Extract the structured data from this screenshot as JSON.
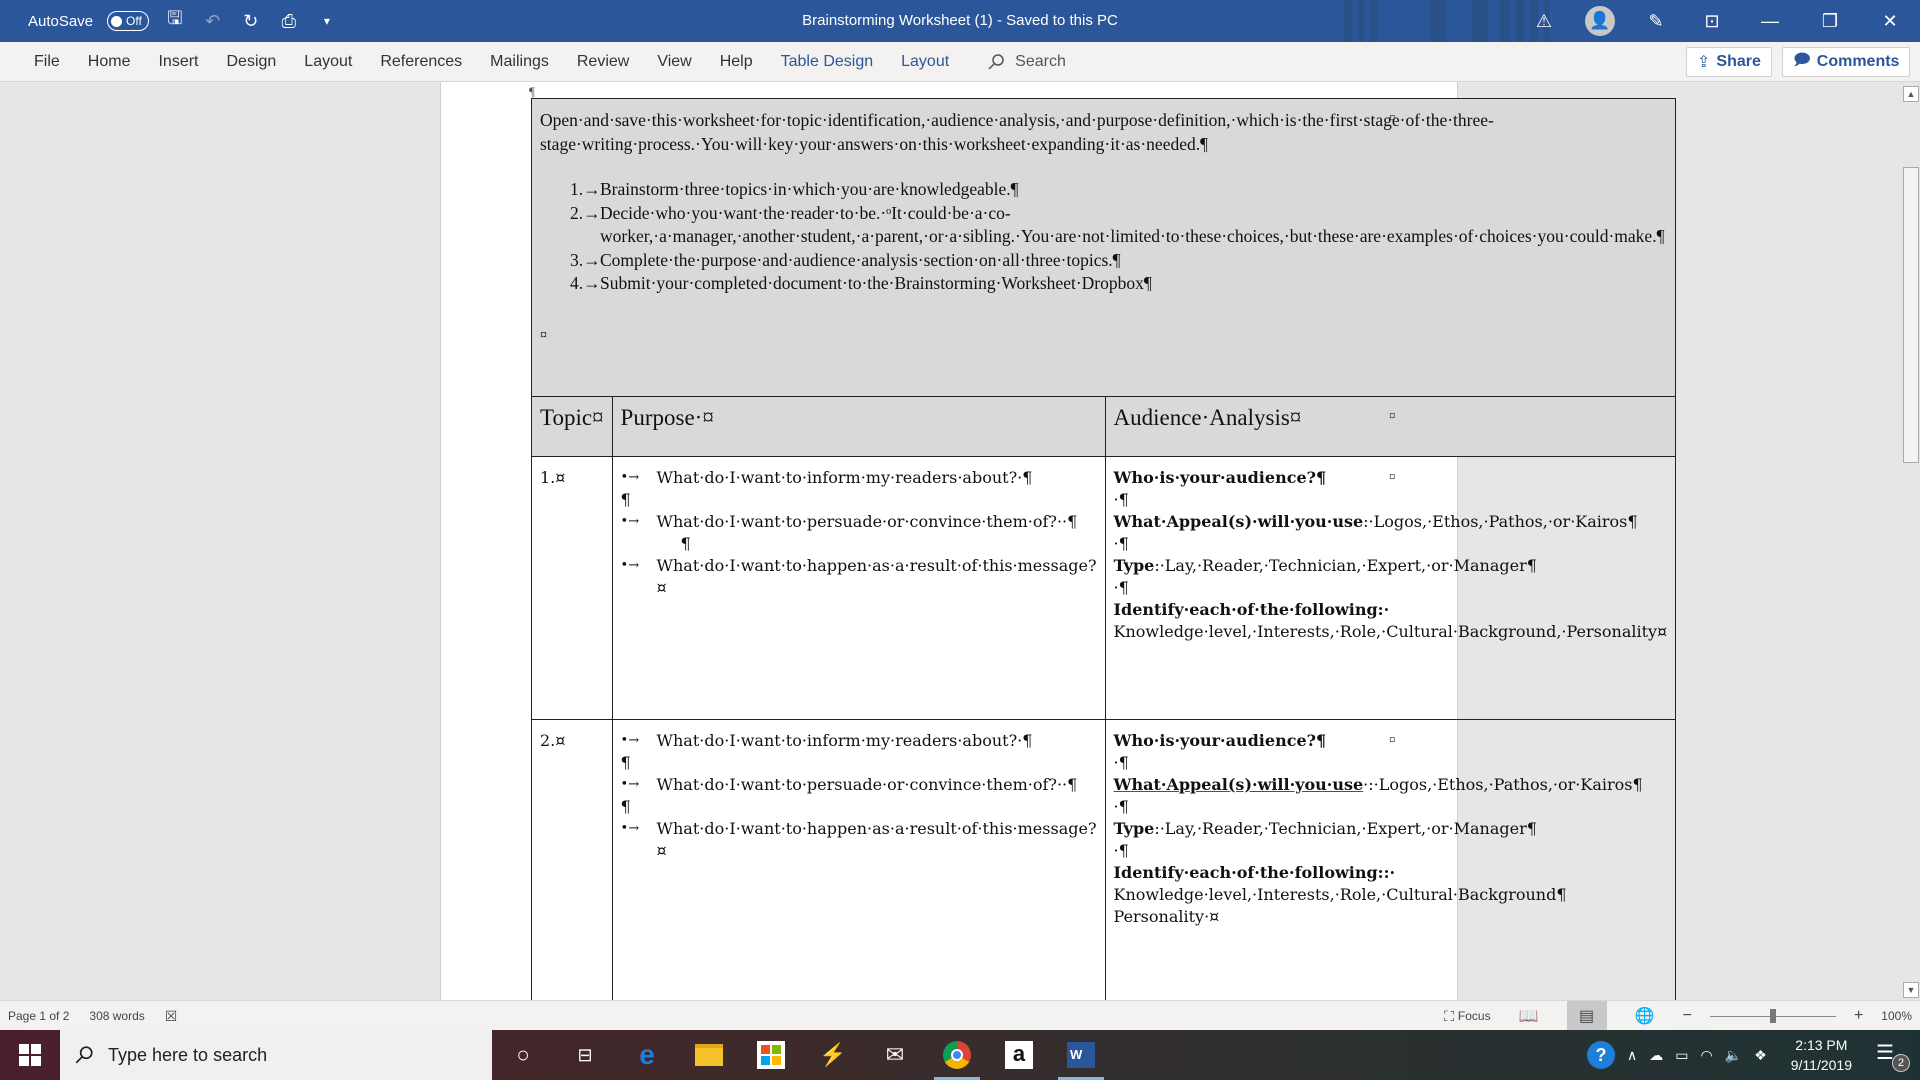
{
  "titlebar": {
    "autosave_label": "AutoSave",
    "autosave_state": "Off",
    "title": "Brainstorming Worksheet (1)  -  Saved to this PC",
    "accent": "#2b579a",
    "icons": [
      "save-icon",
      "undo-icon",
      "redo-icon",
      "print-preview-icon",
      "customize-qat-icon"
    ],
    "window_icons": [
      "warning-icon",
      "account-icon",
      "pen-icon",
      "ribbon-display-icon",
      "minimize-icon",
      "restore-icon",
      "close-icon"
    ],
    "glyphs": {
      "save": "🖫",
      "undo": "↶",
      "redo": "↻",
      "print": "⎙",
      "customize": "▾",
      "warning": "⚠",
      "account": "👤",
      "pen": "✎",
      "ribbon": "⊡",
      "minimize": "—",
      "restore": "❐",
      "close": "✕"
    }
  },
  "ribbon": {
    "tabs": [
      "File",
      "Home",
      "Insert",
      "Design",
      "Layout",
      "References",
      "Mailings",
      "Review",
      "View",
      "Help"
    ],
    "context_tabs": [
      "Table Design",
      "Layout"
    ],
    "search_label": "Search",
    "share_label": "Share",
    "comments_label": "Comments"
  },
  "document": {
    "top_pilcrow": "¶",
    "intro": {
      "paragraph": "Open·and·save·this·worksheet·for·topic·identification,·audience·analysis,·and·purpose·definition,·which·is·the·first·stage·of·the·three-stage·writing·process.·You·will·key·your·answers·on·this·worksheet·expanding·it·as·needed.¶",
      "steps": [
        {
          "num": "1.→",
          "text": "Brainstorm·three·topics·in·which·you·are·knowledgeable.¶"
        },
        {
          "num": "2.→",
          "text": "Decide·who·you·want·the·reader·to·be.·ᵒIt·could·be·a·co-worker,·a·manager,·another·student,·a·parent,·or·a·sibling.·You·are·not·limited·to·these·choices,·but·these·are·examples·of·choices·you·could·make.¶"
        },
        {
          "num": "3.→",
          "text": "Complete·the·purpose·and·audience·analysis·section·on·all·three·topics.¶"
        },
        {
          "num": "4.→",
          "text": "Submit·your·completed·document·to·the·Brainstorming·Worksheet·Dropbox¶"
        }
      ],
      "end_mark": "¤"
    },
    "headers": {
      "topic": "Topic¤",
      "purpose": "Purpose·¤",
      "audience": "Audience·Analysis¤"
    },
    "cell_mark": "¤",
    "rows": [
      {
        "topic": "1.¤",
        "purpose": [
          {
            "bullet": "•→",
            "text": "What·do·I·want·to·inform·my·readers·about?·¶"
          },
          {
            "gap": "¶"
          },
          {
            "bullet": "•→",
            "text": "What·do·I·want·to·persuade·or·convince·them·of?··¶"
          },
          {
            "gap": "¶"
          },
          {
            "bullet": "•→",
            "text": "What·do·I·want·to·happen·as·a·result·of·this·message?¤"
          }
        ],
        "audience": {
          "who": "Who·is·your·audience?¶",
          "blank": "·¶",
          "appeal_label": "What·Appeal(s)·will·you·use",
          "appeal_text": ":·Logos,·Ethos,·Pathos,·or·Kairos¶",
          "type_label": "Type",
          "type_text": ":·Lay,·Reader,·Technician,·Expert,·or·Manager¶",
          "identify_label": "Identify·each·of·the·following:·",
          "identify_text": "Knowledge·level,·Interests,·Role,·Cultural·Background,·Personality¤"
        }
      },
      {
        "topic": "2.¤",
        "purpose": [
          {
            "bullet": "•→",
            "text": "What·do·I·want·to·inform·my·readers·about?·¶"
          },
          {
            "gap": "¶"
          },
          {
            "bullet": "•→",
            "text": "What·do·I·want·to·persuade·or·convince·them·of?··¶"
          },
          {
            "gap": "¶"
          },
          {
            "bullet": "•→",
            "text": "What·do·I·want·to·happen·as·a·result·of·this·message?¤"
          }
        ],
        "audience": {
          "who": "Who·is·your·audience?¶",
          "blank": "·¶",
          "appeal_label": "What·Appeal(s)·will·you·use",
          "appeal_text": "·:·Logos,·Ethos,·Pathos,·or·Kairos¶",
          "type_label": "Type",
          "type_text": ":·Lay,·Reader,·Technician,·Expert,·or·Manager¶",
          "identify_label": "Identify·each·of·the·following::·",
          "identify_text": "Knowledge·level,·Interests,·Role,·Cultural·Background¶",
          "identify_text2": "Personality·¤"
        }
      }
    ]
  },
  "statusbar": {
    "page": "Page 1 of 2",
    "words": "308 words",
    "focus_label": "Focus",
    "zoom_minus": "−",
    "zoom_plus": "+",
    "zoom_level": "100%",
    "zoom_fraction": 0.5
  },
  "taskbar": {
    "search_placeholder": "Type here to search",
    "apps": [
      "cortana",
      "task-view",
      "edge",
      "file-explorer",
      "store",
      "app-blue",
      "mail",
      "chrome",
      "amazon",
      "word"
    ],
    "time": "2:13 PM",
    "date": "9/11/2019",
    "notifications": "2"
  }
}
